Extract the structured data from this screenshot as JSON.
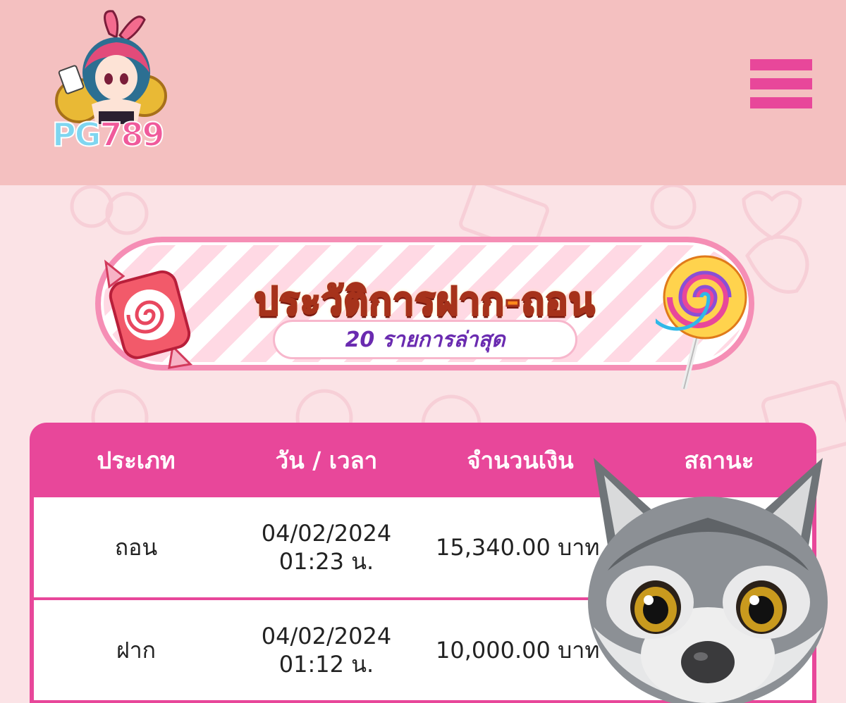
{
  "header": {
    "logo_text_part1": "PG",
    "logo_text_part2": "789",
    "menu_icon": "hamburger-menu-icon"
  },
  "banner": {
    "title": "ประวัติการฝาก-ถอน",
    "subtitle": "20 รายการล่าสุด",
    "left_icon": "candy-icon",
    "right_icon": "lollipop-icon"
  },
  "table": {
    "columns": [
      "ประเภท",
      "วัน / เวลา",
      "จำนวนเงิน",
      "สถานะ"
    ],
    "rows": [
      {
        "type": "ถอน",
        "date": "04/02/2024",
        "time": "01:23 น.",
        "amount": "15,340.00 บาท",
        "status": ""
      },
      {
        "type": "ฝาก",
        "date": "04/02/2024",
        "time": "01:12 น.",
        "amount": "10,000.00 บาท",
        "status": ""
      }
    ]
  },
  "colors": {
    "header_bg": "#f4c0c0",
    "page_bg": "#fbe3e6",
    "accent_pink": "#e8479a",
    "subtitle_purple": "#6a2bb0"
  },
  "overlay": {
    "icon": "wolf-avatar-icon"
  }
}
